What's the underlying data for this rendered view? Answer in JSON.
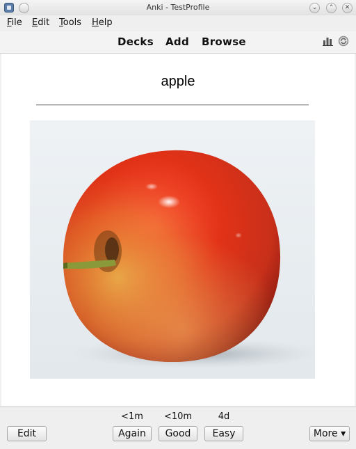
{
  "window": {
    "title": "Anki - TestProfile",
    "app_icon": "anki-icon"
  },
  "menubar": {
    "items": [
      {
        "label": "File",
        "mnemonic": "F",
        "rest": "ile"
      },
      {
        "label": "Edit",
        "mnemonic": "E",
        "rest": "dit"
      },
      {
        "label": "Tools",
        "mnemonic": "T",
        "rest": "ools"
      },
      {
        "label": "Help",
        "mnemonic": "H",
        "rest": "elp"
      }
    ]
  },
  "toolbar": {
    "links": [
      "Decks",
      "Add",
      "Browse"
    ],
    "right_icons": [
      "stats-icon",
      "sync-icon"
    ]
  },
  "card": {
    "front_text": "apple",
    "image": "red-apple-photo"
  },
  "answer": {
    "intervals": [
      "<1m",
      "<10m",
      "4d"
    ],
    "edit_label": "Edit",
    "buttons": [
      "Again",
      "Good",
      "Easy"
    ],
    "more_label": "More ▾"
  }
}
